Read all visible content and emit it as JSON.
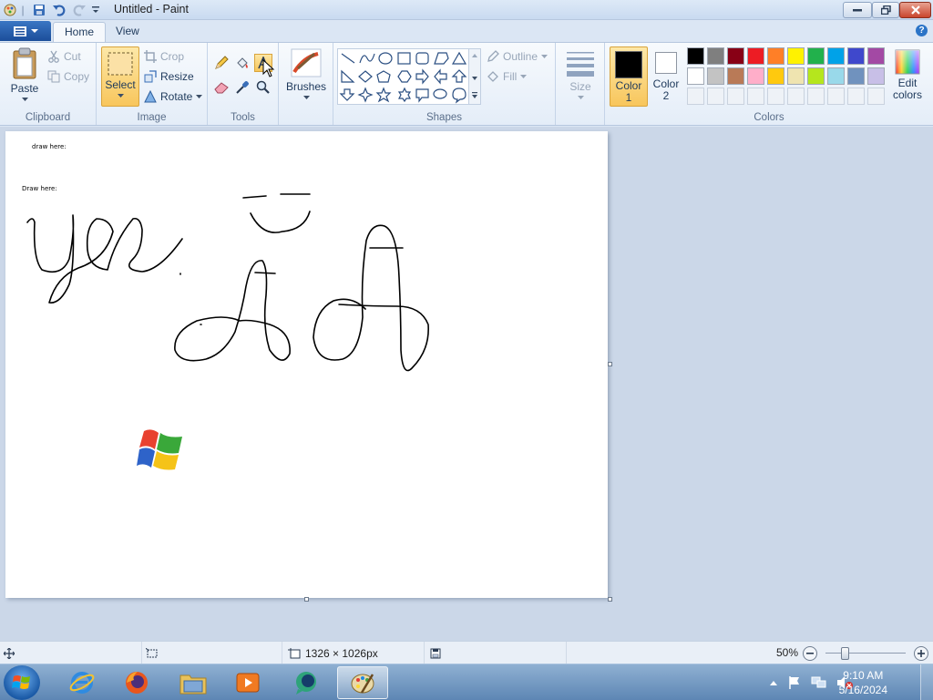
{
  "window": {
    "title": "Untitled - Paint"
  },
  "tabs": [
    {
      "label": "Home",
      "active": true
    },
    {
      "label": "View",
      "active": false
    }
  ],
  "ribbon": {
    "clipboard": {
      "group_label": "Clipboard",
      "paste": "Paste",
      "cut": "Cut",
      "copy": "Copy"
    },
    "image": {
      "group_label": "Image",
      "select": "Select",
      "crop": "Crop",
      "resize": "Resize",
      "rotate": "Rotate"
    },
    "tools": {
      "group_label": "Tools",
      "selected_tool": "text-tool"
    },
    "brushes": {
      "label": "Brushes"
    },
    "shapes": {
      "group_label": "Shapes",
      "outline": "Outline",
      "fill": "Fill"
    },
    "size": {
      "label": "Size"
    },
    "colors": {
      "group_label": "Colors",
      "color1_label_line1": "Color",
      "color1_label_line2": "1",
      "color2_label_line1": "Color",
      "color2_label_line2": "2",
      "color1": "#000000",
      "color2": "#ffffff",
      "edit_line1": "Edit",
      "edit_line2": "colors",
      "palette_row1": [
        "#000000",
        "#7f7f7f",
        "#880015",
        "#ed1c24",
        "#ff7f27",
        "#fff200",
        "#22b14c",
        "#00a2e8",
        "#3f48cc",
        "#a349a4"
      ],
      "palette_row2": [
        "#ffffff",
        "#c3c3c3",
        "#b97a57",
        "#ffaec9",
        "#ffc90e",
        "#efe4b0",
        "#b5e61d",
        "#99d9ea",
        "#7092be",
        "#c8bfe7"
      ]
    }
  },
  "canvas": {
    "text1": "draw here:",
    "text2": "Draw here:"
  },
  "status": {
    "canvas_size": "1326 × 1026px",
    "zoom": "50%"
  },
  "taskbar": {
    "apps": [
      "internet-explorer",
      "firefox",
      "file-explorer",
      "media-player",
      "chat-app",
      "paint"
    ],
    "time": "9:10 AM",
    "date": "5/16/2024"
  }
}
